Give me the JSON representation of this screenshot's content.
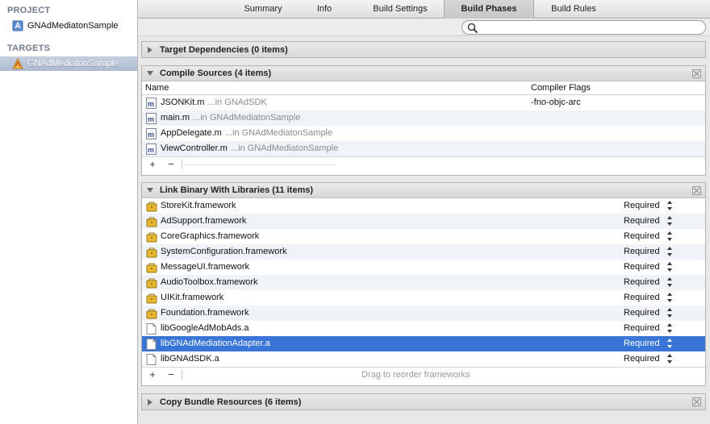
{
  "sidebar": {
    "project_heading": "PROJECT",
    "project_item": "GNAdMediatonSample",
    "targets_heading": "TARGETS",
    "target_item": "GNAdMediatonSample"
  },
  "tabs": [
    "Summary",
    "Info",
    "Build Settings",
    "Build Phases",
    "Build Rules"
  ],
  "active_tab": "Build Phases",
  "search": {
    "placeholder": "",
    "value": ""
  },
  "sections": {
    "target_dependencies": {
      "title": "Target Dependencies (0 items)"
    },
    "compile_sources": {
      "title": "Compile Sources (4 items)",
      "col_name": "Name",
      "col_flags": "Compiler Flags",
      "rows": [
        {
          "name": "JSONKit.m",
          "path": "...in GNAdSDK",
          "flags": "-fno-objc-arc"
        },
        {
          "name": "main.m",
          "path": "...in GNAdMediatonSample",
          "flags": ""
        },
        {
          "name": "AppDelegate.m",
          "path": "...in GNAdMediatonSample",
          "flags": ""
        },
        {
          "name": "ViewController.m",
          "path": "...in GNAdMediatonSample",
          "flags": ""
        }
      ],
      "add_label": "+",
      "remove_label": "−"
    },
    "link_binary": {
      "title": "Link Binary With Libraries (11 items)",
      "rows": [
        {
          "name": "StoreKit.framework",
          "status": "Required",
          "kind": "framework"
        },
        {
          "name": "AdSupport.framework",
          "status": "Required",
          "kind": "framework"
        },
        {
          "name": "CoreGraphics.framework",
          "status": "Required",
          "kind": "framework"
        },
        {
          "name": "SystemConfiguration.framework",
          "status": "Required",
          "kind": "framework"
        },
        {
          "name": "MessageUI.framework",
          "status": "Required",
          "kind": "framework"
        },
        {
          "name": "AudioToolbox.framework",
          "status": "Required",
          "kind": "framework"
        },
        {
          "name": "UIKit.framework",
          "status": "Required",
          "kind": "framework"
        },
        {
          "name": "Foundation.framework",
          "status": "Required",
          "kind": "framework"
        },
        {
          "name": "libGoogleAdMobAds.a",
          "status": "Required",
          "kind": "lib"
        },
        {
          "name": "libGNAdMediationAdapter.a",
          "status": "Required",
          "kind": "lib"
        },
        {
          "name": "libGNAdSDK.a",
          "status": "Required",
          "kind": "lib"
        }
      ],
      "selected_row": "libGNAdMediationAdapter.a",
      "add_label": "+",
      "remove_label": "−",
      "hint": "Drag to reorder frameworks"
    },
    "copy_bundle": {
      "title": "Copy Bundle Resources (6 items)"
    }
  },
  "colors": {
    "selection": "#3875d7",
    "sidebar_heading": "#6f7b8a",
    "alt_row": "#f0f4f8"
  }
}
